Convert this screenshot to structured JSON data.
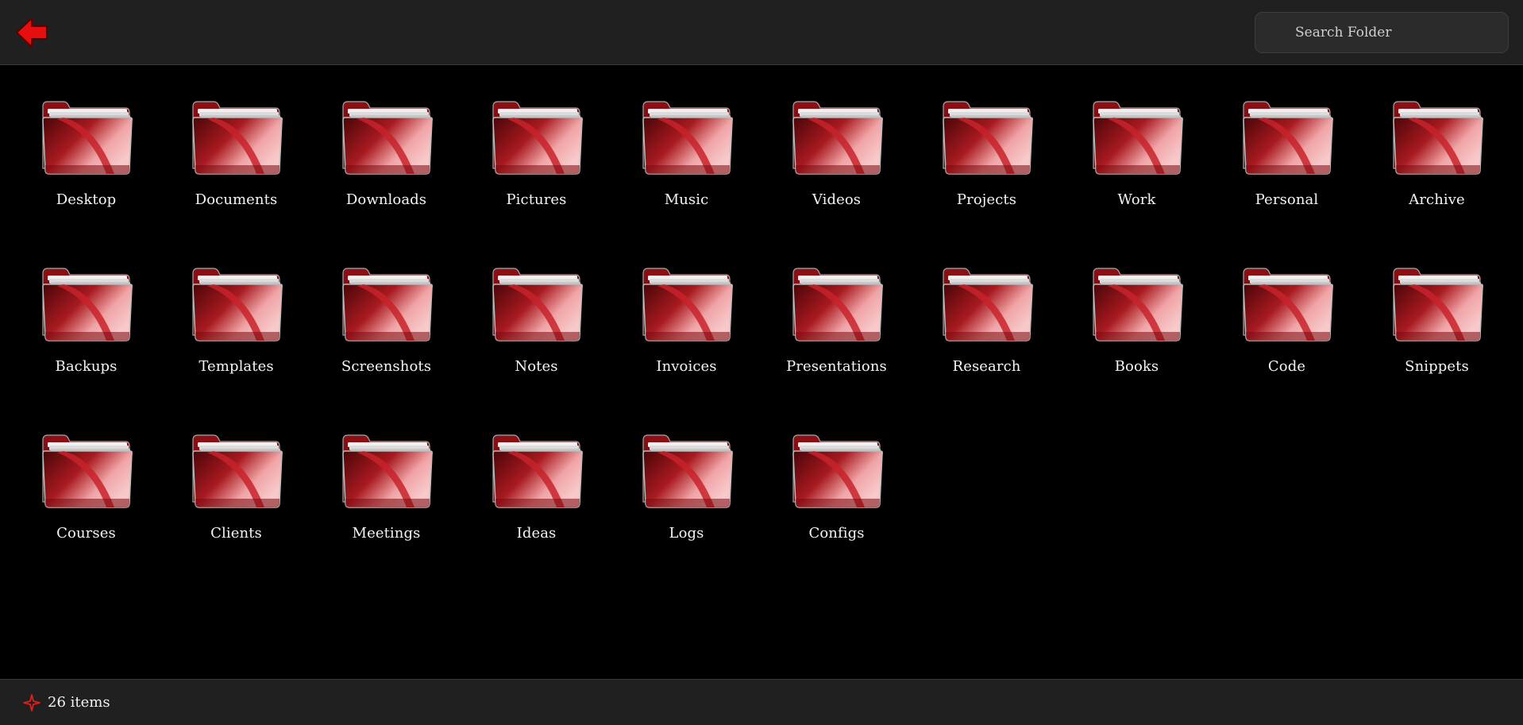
{
  "header": {
    "back_icon": "arrow-left-icon",
    "search_placeholder": "Search Folder"
  },
  "colors": {
    "accent": "#e11d1d",
    "folder_red": "#b3171d",
    "background": "#000000",
    "bar_background": "#202020"
  },
  "folders": [
    {
      "label": "Desktop"
    },
    {
      "label": "Documents"
    },
    {
      "label": "Downloads"
    },
    {
      "label": "Pictures"
    },
    {
      "label": "Music"
    },
    {
      "label": "Videos"
    },
    {
      "label": "Projects"
    },
    {
      "label": "Work"
    },
    {
      "label": "Personal"
    },
    {
      "label": "Archive"
    },
    {
      "label": "Backups"
    },
    {
      "label": "Templates"
    },
    {
      "label": "Screenshots"
    },
    {
      "label": "Notes"
    },
    {
      "label": "Invoices"
    },
    {
      "label": "Presentations"
    },
    {
      "label": "Research"
    },
    {
      "label": "Books"
    },
    {
      "label": "Code"
    },
    {
      "label": "Snippets"
    },
    {
      "label": "Courses"
    },
    {
      "label": "Clients"
    },
    {
      "label": "Meetings"
    },
    {
      "label": "Ideas"
    },
    {
      "label": "Logs"
    },
    {
      "label": "Configs"
    }
  ],
  "status": {
    "icon": "sparkle-icon",
    "count_text": "26 items"
  }
}
